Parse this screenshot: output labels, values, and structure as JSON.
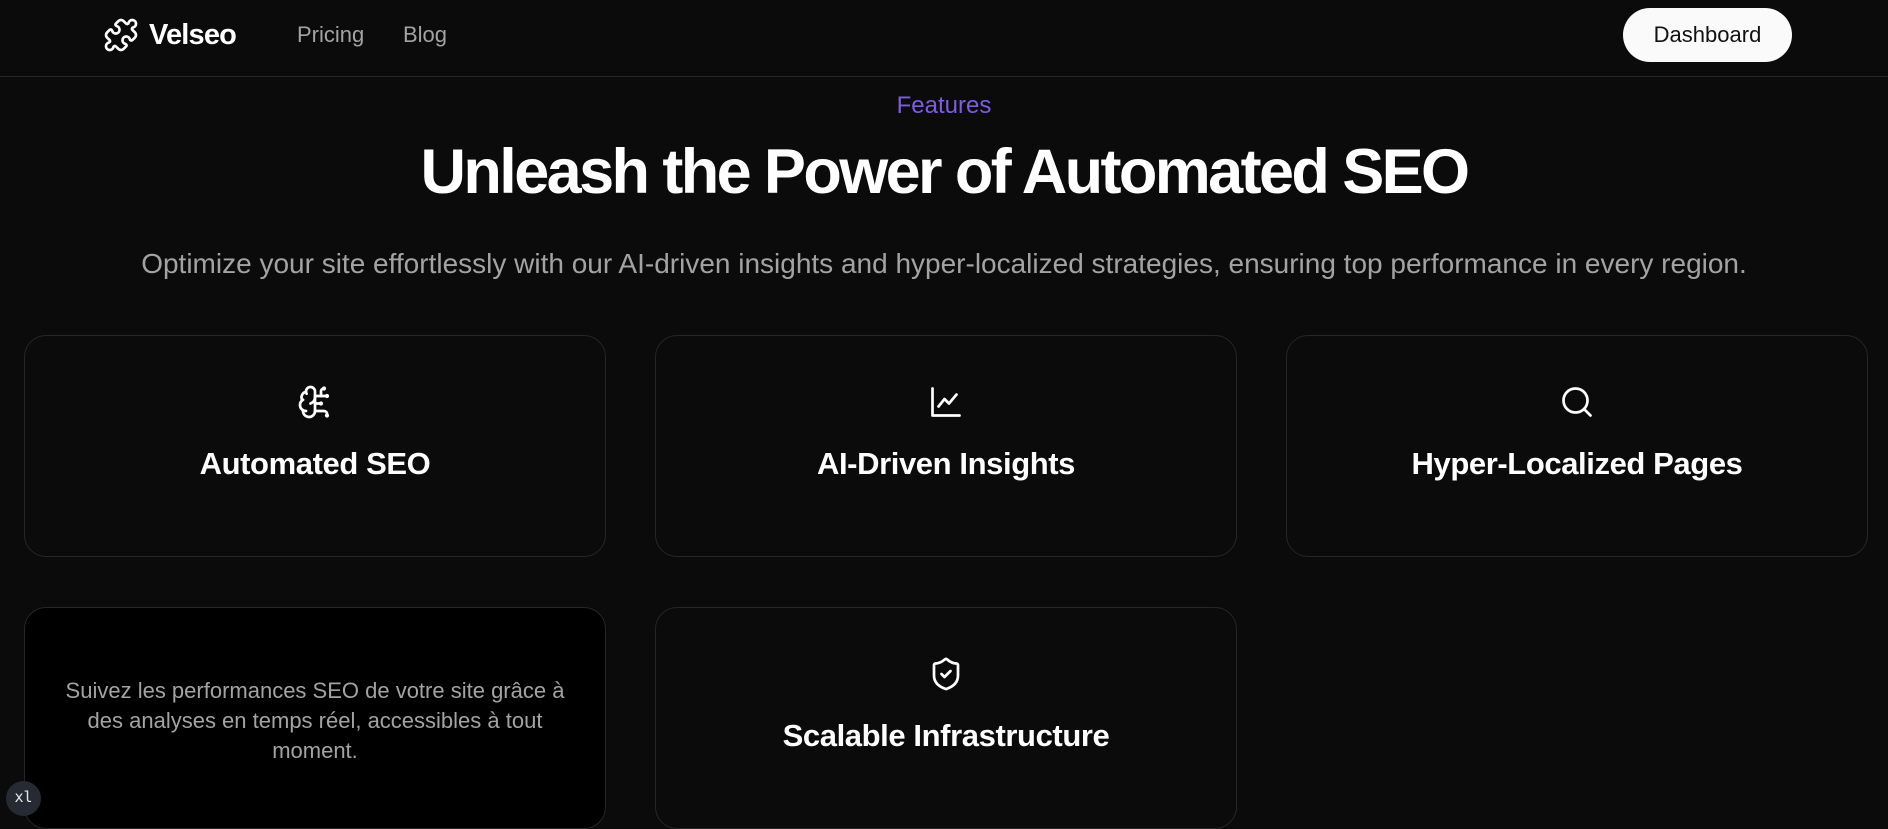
{
  "nav": {
    "brand": "Velseo",
    "brand_icon": "puzzle-icon",
    "links": [
      "Pricing",
      "Blog"
    ],
    "dashboard_label": "Dashboard"
  },
  "hero": {
    "eyebrow": "Features",
    "title": "Unleash the Power of Automated SEO",
    "subtitle": "Optimize your site effortlessly with our AI-driven insights and hyper-localized strategies, ensuring top performance in every region."
  },
  "features": [
    {
      "title": "Automated SEO",
      "icon": "brain-icon"
    },
    {
      "title": "AI-Driven Insights",
      "icon": "line-chart-icon"
    },
    {
      "title": "Hyper-Localized Pages",
      "icon": "search-icon"
    },
    {
      "description": "Suivez les performances SEO de votre site grâce à des analyses en temps réel, accessibles à tout moment."
    },
    {
      "title": "Scalable Infrastructure",
      "icon": "shield-check-icon"
    }
  ],
  "breakpoint_badge": "xl",
  "colors": {
    "background": "#0b0b0b",
    "accent": "#7c5ce0",
    "muted_text": "#a3a3a3",
    "border": "#262626"
  }
}
